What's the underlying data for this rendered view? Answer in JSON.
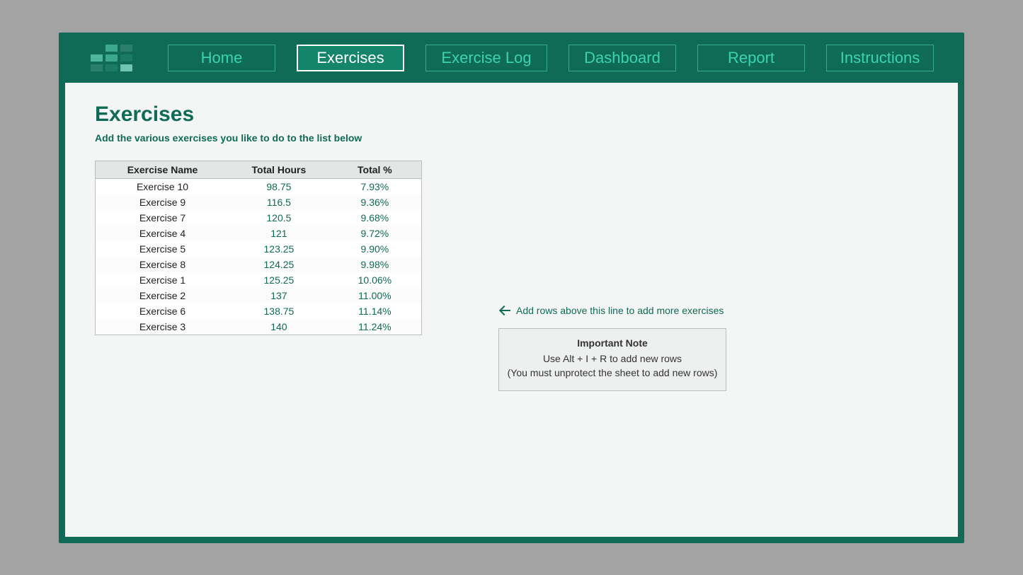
{
  "nav": {
    "items": [
      {
        "label": "Home",
        "active": false
      },
      {
        "label": "Exercises",
        "active": true
      },
      {
        "label": "Exercise Log",
        "active": false
      },
      {
        "label": "Dashboard",
        "active": false
      },
      {
        "label": "Report",
        "active": false
      },
      {
        "label": "Instructions",
        "active": false
      }
    ]
  },
  "page": {
    "title": "Exercises",
    "subtitle": "Add the various exercises you like to do to the list below"
  },
  "table": {
    "headers": {
      "name": "Exercise Name",
      "hours": "Total Hours",
      "pct": "Total %"
    },
    "rows": [
      {
        "name": "Exercise 10",
        "hours": "98.75",
        "pct": "7.93%"
      },
      {
        "name": "Exercise 9",
        "hours": "116.5",
        "pct": "9.36%"
      },
      {
        "name": "Exercise 7",
        "hours": "120.5",
        "pct": "9.68%"
      },
      {
        "name": "Exercise 4",
        "hours": "121",
        "pct": "9.72%"
      },
      {
        "name": "Exercise 5",
        "hours": "123.25",
        "pct": "9.90%"
      },
      {
        "name": "Exercise 8",
        "hours": "124.25",
        "pct": "9.98%"
      },
      {
        "name": "Exercise 1",
        "hours": "125.25",
        "pct": "10.06%"
      },
      {
        "name": "Exercise 2",
        "hours": "137",
        "pct": "11.00%"
      },
      {
        "name": "Exercise 6",
        "hours": "138.75",
        "pct": "11.14%"
      },
      {
        "name": "Exercise 3",
        "hours": "140",
        "pct": "11.24%"
      }
    ]
  },
  "hint": "Add rows above this line to add more exercises",
  "note": {
    "title": "Important Note",
    "line1": "Use Alt + I + R to add new rows",
    "line2": "(You must unprotect the sheet to add new rows)"
  }
}
